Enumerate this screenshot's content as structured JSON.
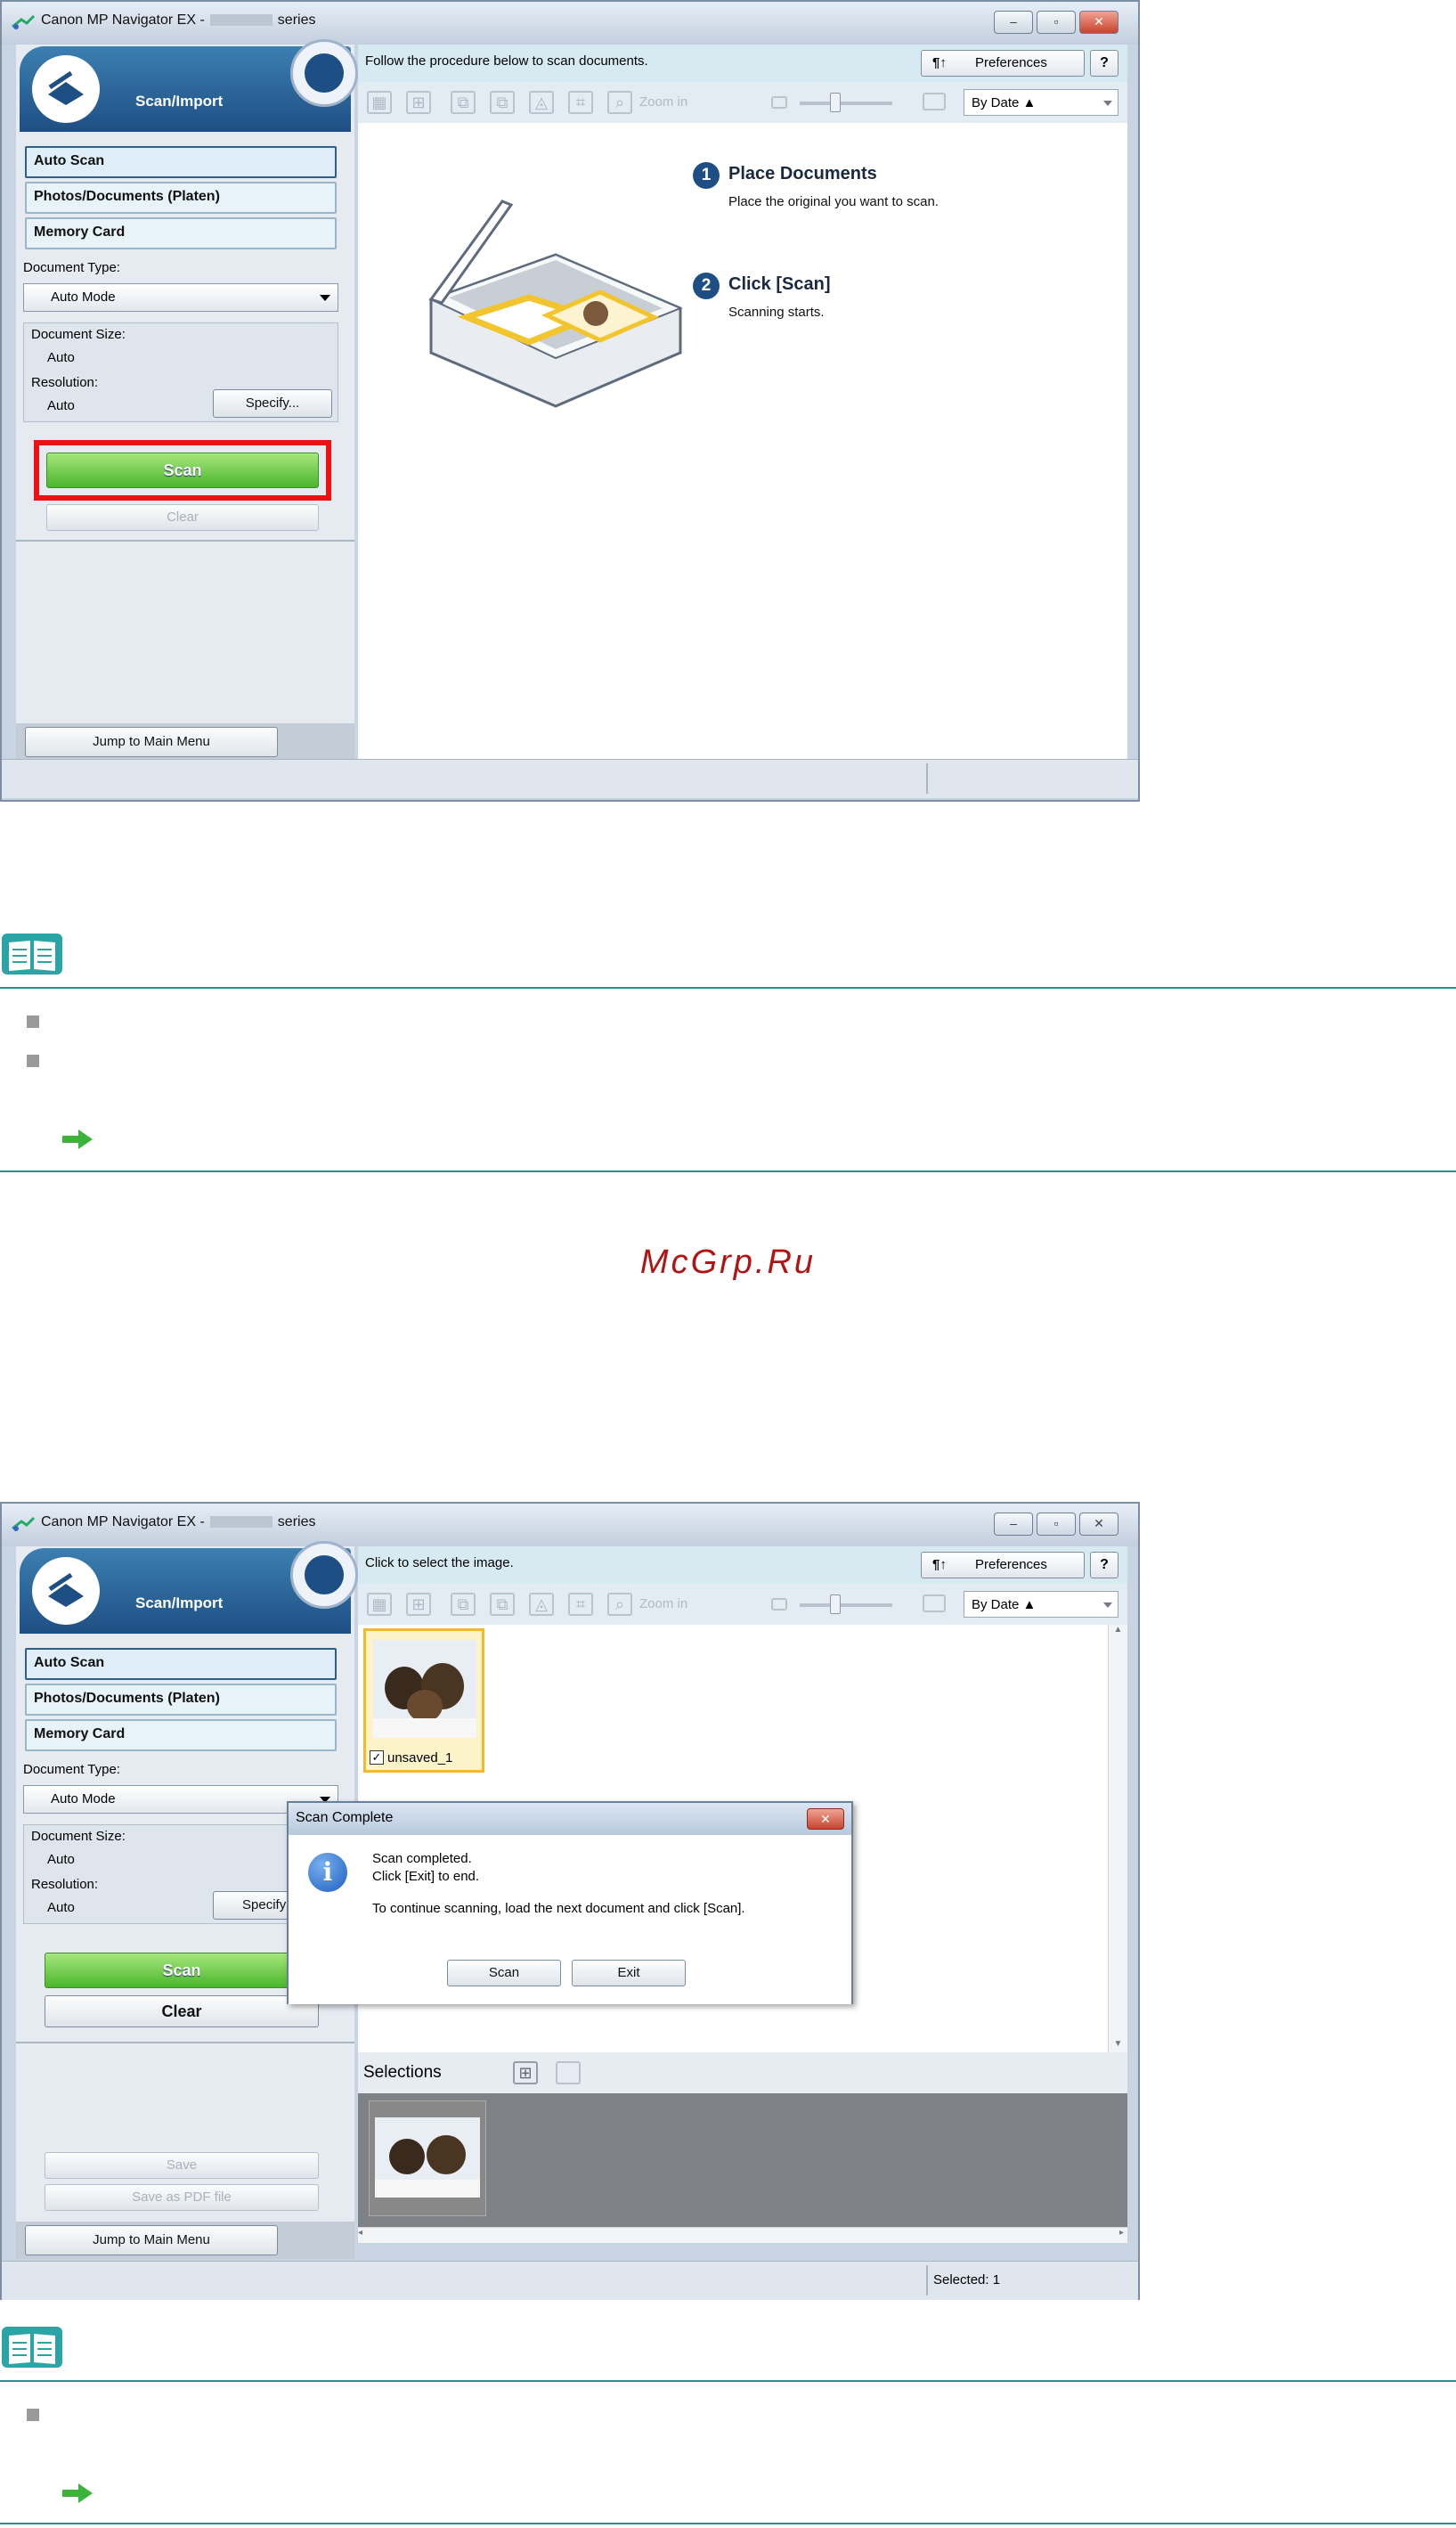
{
  "window1": {
    "title_prefix": "Canon MP Navigator EX -",
    "title_suffix": "series",
    "panel_title": "Scan/Import",
    "side_buttons": [
      "Auto Scan",
      "Photos/Documents (Platen)",
      "Memory Card"
    ],
    "document_type_label": "Document Type:",
    "document_type_value": "Auto Mode",
    "document_size_label": "Document Size:",
    "document_size_value": "Auto",
    "resolution_label": "Resolution:",
    "resolution_value": "Auto",
    "specify_label": "Specify...",
    "scan_label": "Scan",
    "clear_label": "Clear",
    "jump_label": "Jump to Main Menu",
    "instruction": "Follow the procedure below to scan documents.",
    "preferences_label": "Preferences",
    "help_label": "?",
    "zoom_label": "Zoom in",
    "sort_label": "By Date",
    "steps": [
      {
        "num": "1",
        "title": "Place Documents",
        "desc": "Place the original you want to scan."
      },
      {
        "num": "2",
        "title": "Click [Scan]",
        "desc": "Scanning starts."
      }
    ]
  },
  "watermark": "McGrp.Ru",
  "window2": {
    "title_prefix": "Canon MP Navigator EX -",
    "title_suffix": "series",
    "panel_title": "Scan/Import",
    "side_buttons": [
      "Auto Scan",
      "Photos/Documents (Platen)",
      "Memory Card"
    ],
    "document_type_label": "Document Type:",
    "document_type_value": "Auto Mode",
    "document_size_label": "Document Size:",
    "document_size_value": "Auto",
    "resolution_label": "Resolution:",
    "resolution_value": "Auto",
    "specify_label": "Specify",
    "scan_label": "Scan",
    "clear_label": "Clear",
    "save_label": "Save",
    "save_pdf_label": "Save as PDF file",
    "jump_label": "Jump to Main Menu",
    "instruction": "Click to select the image.",
    "preferences_label": "Preferences",
    "help_label": "?",
    "zoom_label": "Zoom in",
    "sort_label": "By Date",
    "thumb_label": "unsaved_1",
    "selections_label": "Selections",
    "status_selected": "Selected: 1",
    "dialog": {
      "title": "Scan Complete",
      "line1": "Scan completed.",
      "line2": "Click [Exit] to end.",
      "line3": "To continue scanning, load the next document and click [Scan].",
      "scan_button": "Scan",
      "exit_button": "Exit"
    }
  },
  "colors": {
    "accent": "#2a8c8c",
    "scan_green": "#4ab62c",
    "highlight_red": "#e11111",
    "window_blue": "#1e4f84",
    "watermark": "#b01515"
  },
  "icons": [
    "note-icon",
    "bullet-icon",
    "arrow-icon",
    "scanner-icon",
    "globe-icon",
    "info-icon"
  ]
}
